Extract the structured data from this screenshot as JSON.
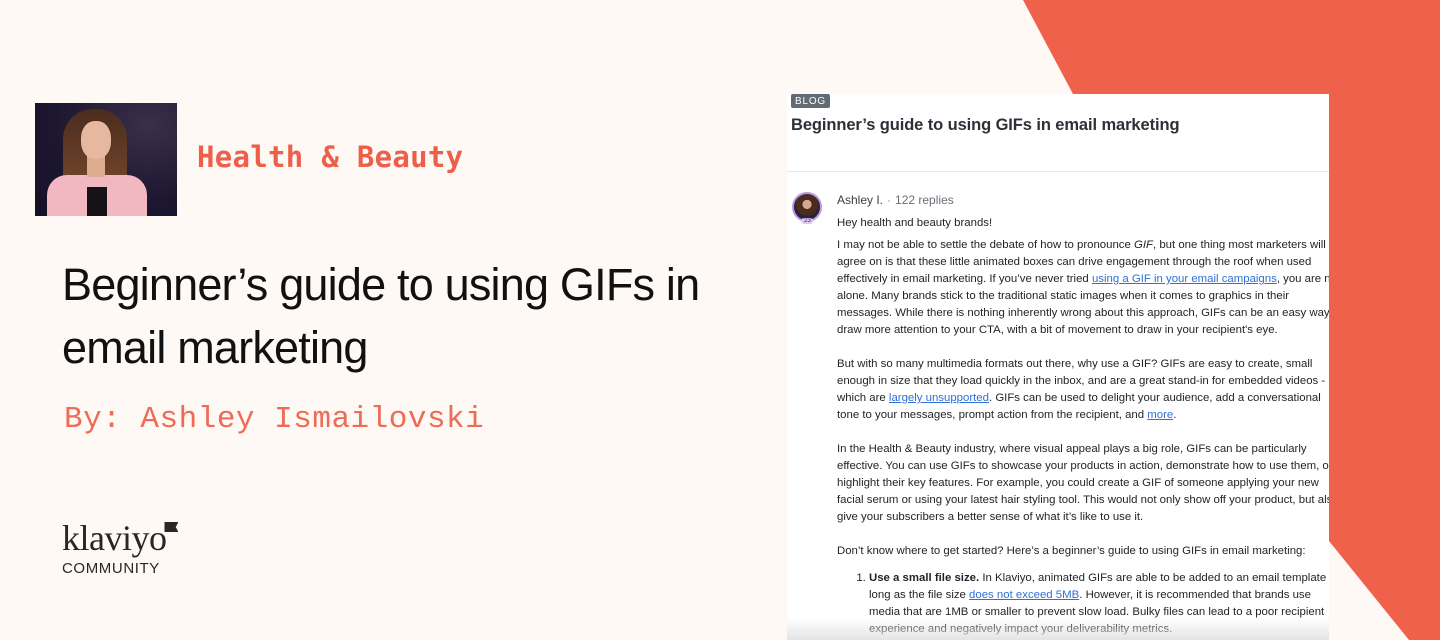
{
  "colors": {
    "background": "#fef9f4",
    "accent": "#ee5f4a",
    "byline": "#ee6b56",
    "link": "#2f6fd6",
    "tag_bg": "#626b73"
  },
  "hero": {
    "category": "Health & Beauty",
    "title": "Beginner’s guide to using GIFs in email marketing",
    "byline": "By: Ashley Ismailovski",
    "photo_alt": "Author headshot"
  },
  "logo": {
    "wordmark": "klaviyo",
    "subtitle": "COMMUNITY"
  },
  "post": {
    "tag": "BLOG",
    "title": "Beginner’s guide to using GIFs in email marketing",
    "author": "Ashley I.",
    "separator": "·",
    "replies": "122 replies",
    "avatar_badge": "'23",
    "greeting": "Hey health and beauty brands!",
    "p1": {
      "lines": [
        [
          "I may not be able to settle the debate of how to pronounce ",
          "GIF",
          ", but one thing most marketers will"
        ],
        "agree on is that these little animated boxes can drive engagement through the roof when used",
        [
          "effectively in email marketing. If you’ve never tried ",
          "using a GIF in your email campaigns",
          ", you are not"
        ],
        "alone. Many brands stick to the traditional static images when it comes to graphics in their",
        "messages. While there is nothing inherently wrong about this approach, GIFs can be an easy way to",
        "draw more attention to your CTA, with a bit of movement to draw in your recipient's eye."
      ]
    },
    "p2": {
      "line1": "But with so many multimedia formats out there, why use a GIF? GIFs are easy to create, small",
      "line2": "enough in size that they load quickly in the inbox, and are a great stand-in for embedded videos -",
      "line3_pre": "which are ",
      "line3_link": "largely unsupported",
      "line3_post": ". GIFs can be used to delight your audience, add a conversational",
      "line4_pre": "tone to your messages, prompt action from the recipient, and ",
      "line4_link": "more",
      "line4_post": "."
    },
    "p3": {
      "line1": "In the Health & Beauty industry, where visual appeal plays a big role, GIFs can be particularly",
      "line2": "effective. You can use GIFs to showcase your products in action, demonstrate how to use them, or",
      "line3": "highlight their key features. For example, you could create a GIF of someone applying your new",
      "line4": "facial serum or using your latest hair styling tool. This would not only show off your product, but also",
      "line5": "give your subscribers a better sense of what it’s like to use it."
    },
    "p4": "Don’t know where to get started? Here’s a beginner’s guide to using GIFs in email marketing:",
    "list": [
      {
        "bold": "Use a small file size.",
        "line1_post": " In Klaviyo, animated GIFs are able to be added to an email template as",
        "line2_pre": "long as the file size ",
        "line2_link": "does not exceed 5MB",
        "line2_post": ". However, it is recommended that brands use",
        "line3": "media that are 1MB or smaller to prevent slow load. Bulky files can lead to a poor recipient",
        "line4": "experience and negatively impact your deliverability metrics."
      }
    ]
  }
}
